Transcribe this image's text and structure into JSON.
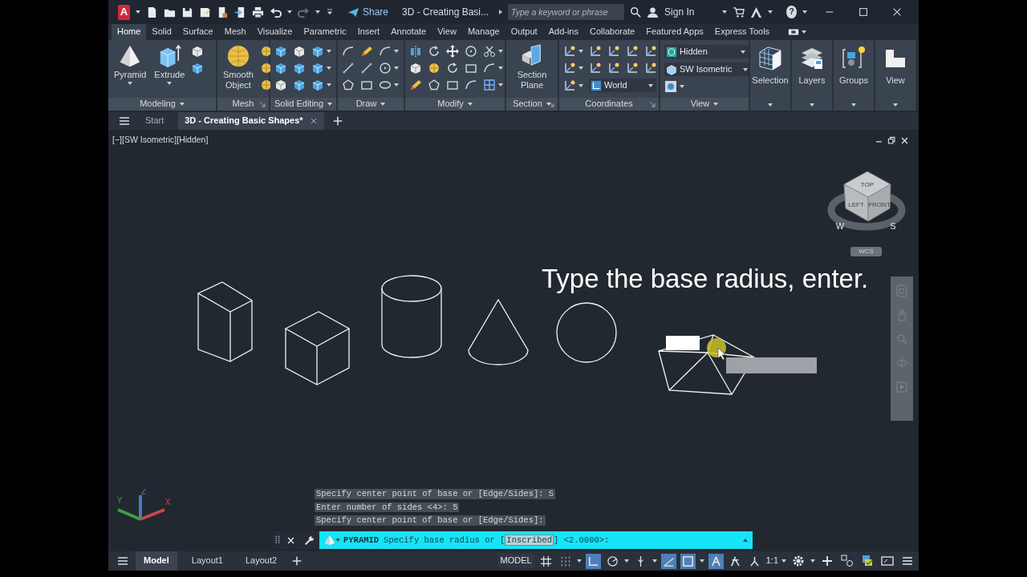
{
  "title_bar": {
    "app_letter": "A",
    "share": "Share",
    "document_title": "3D - Creating Basi...",
    "search": {
      "placeholder": "Type a keyword or phrase"
    },
    "sign_in": "Sign In",
    "help": "?"
  },
  "ribbon_tabs": [
    {
      "label": "Home",
      "selected": true
    },
    {
      "label": "Solid",
      "selected": false
    },
    {
      "label": "Surface",
      "selected": false
    },
    {
      "label": "Mesh",
      "selected": false
    },
    {
      "label": "Visualize",
      "selected": false
    },
    {
      "label": "Parametric",
      "selected": false
    },
    {
      "label": "Insert",
      "selected": false
    },
    {
      "label": "Annotate",
      "selected": false
    },
    {
      "label": "View",
      "selected": false
    },
    {
      "label": "Manage",
      "selected": false
    },
    {
      "label": "Output",
      "selected": false
    },
    {
      "label": "Add-ins",
      "selected": false
    },
    {
      "label": "Collaborate",
      "selected": false
    },
    {
      "label": "Featured Apps",
      "selected": false
    },
    {
      "label": "Express Tools",
      "selected": false
    }
  ],
  "ribbon_panels": [
    {
      "title": "Modeling",
      "buttons": [
        "Pyramid",
        "Extrude"
      ]
    },
    {
      "title": "Mesh",
      "buttons": [
        "Smooth Object"
      ]
    },
    {
      "title": "Solid Editing"
    },
    {
      "title": "Draw"
    },
    {
      "title": "Modify"
    },
    {
      "title": "Section",
      "buttons": [
        "Section Plane"
      ]
    },
    {
      "title": "Coordinates",
      "dropdowns": [
        "World"
      ]
    },
    {
      "title": "View",
      "dropdowns": [
        "Hidden",
        "SW Isometric"
      ]
    }
  ],
  "ribbon_tools": [
    "Selection",
    "Layers",
    "Groups",
    "View"
  ],
  "file_tabs": [
    {
      "label": "Start",
      "selected": false
    },
    {
      "label": "3D - Creating Basic Shapes*",
      "selected": true
    }
  ],
  "viewport": {
    "label": "[−][SW Isometric][Hidden]",
    "caption": "Type the base radius, enter.",
    "cube_faces": [
      "TOP",
      "LEFT",
      "FRONT"
    ],
    "compass": [
      "W",
      "S"
    ],
    "wcs": "WCS",
    "ucs_axes": [
      "X",
      "Y",
      "Z"
    ]
  },
  "command_history": [
    "Specify center point of base or [Edge/Sides]: S",
    "Enter number of sides <4>: 5",
    "Specify center point of base or [Edge/Sides]:"
  ],
  "command_line": {
    "command": "PYRAMID",
    "prompt": "Specify base radius or [",
    "option": "Inscribed",
    "suffix": "] <2.0000>:"
  },
  "layout_tabs": [
    {
      "label": "Model",
      "selected": true
    },
    {
      "label": "Layout1",
      "selected": false
    },
    {
      "label": "Layout2",
      "selected": false
    }
  ],
  "status_bar": {
    "model": "MODEL",
    "scale": "1:1"
  },
  "status_toggles": [
    {
      "on": false
    },
    {
      "on": false
    },
    {
      "on": true
    },
    {
      "on": false
    },
    {
      "on": false
    },
    {
      "on": true
    },
    {
      "on": true
    },
    {
      "on": true
    },
    {
      "on": false
    },
    {
      "on": false
    }
  ]
}
